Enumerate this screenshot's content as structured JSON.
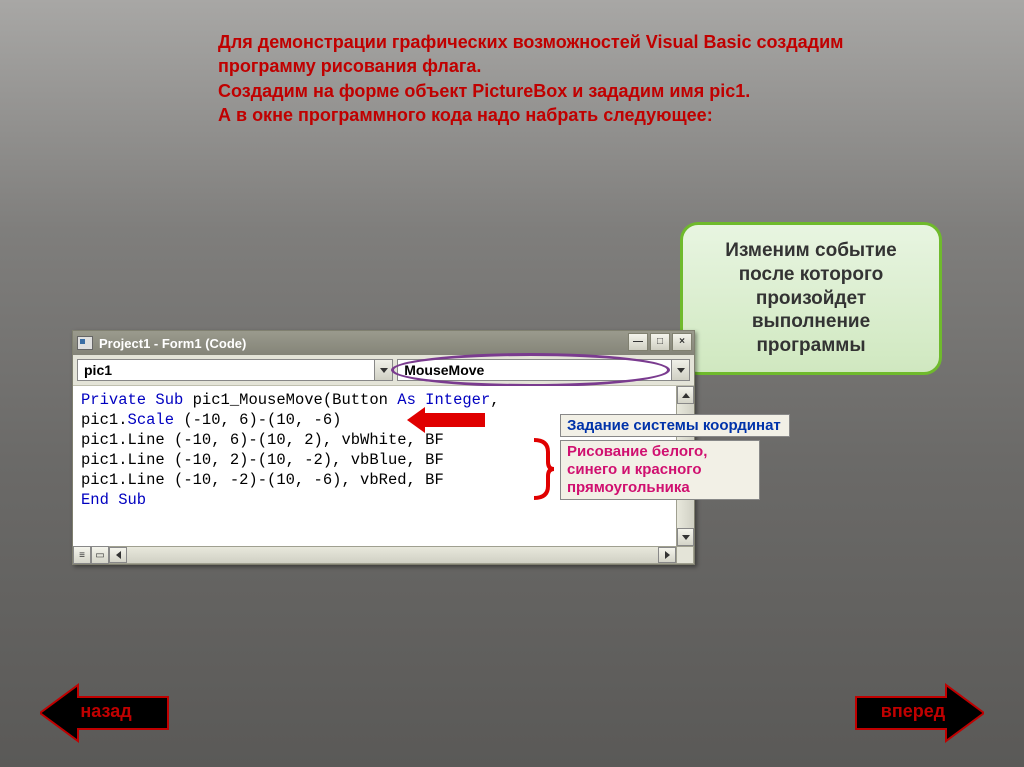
{
  "intro": {
    "line1": "Для демонстрации графических возможностей Visual Basic создадим программу рисования флага.",
    "line2": "Создадим на форме объект PictureBox и зададим имя pic1.",
    "line3": "А в окне программного кода надо набрать следующее:"
  },
  "callout": {
    "text": "Изменим событие после которого произойдет выполнение программы"
  },
  "window": {
    "title": "Project1 - Form1 (Code)",
    "left_combo": "pic1",
    "right_combo": "MouseMove"
  },
  "code": {
    "l1_kw1": "Private Sub",
    "l1_mid": " pic1_MouseMove(Button ",
    "l1_kw2": "As Integer",
    "l1_end": ",",
    "l2": "pic1.Scale (-10, 6)-(10, -6)",
    "l3": "pic1.Line (-10, 6)-(10, 2), vbWhite, BF",
    "l4": "pic1.Line (-10, 2)-(10, -2), vbBlue, BF",
    "l5": "pic1.Line (-10, -2)-(10, -6), vbRed, BF",
    "l6": "End Sub"
  },
  "annotations": {
    "coords": "Задание системы координат",
    "rects": "Рисование белого, синего и красного прямоугольника"
  },
  "nav": {
    "back": "назад",
    "forward": "вперед"
  }
}
